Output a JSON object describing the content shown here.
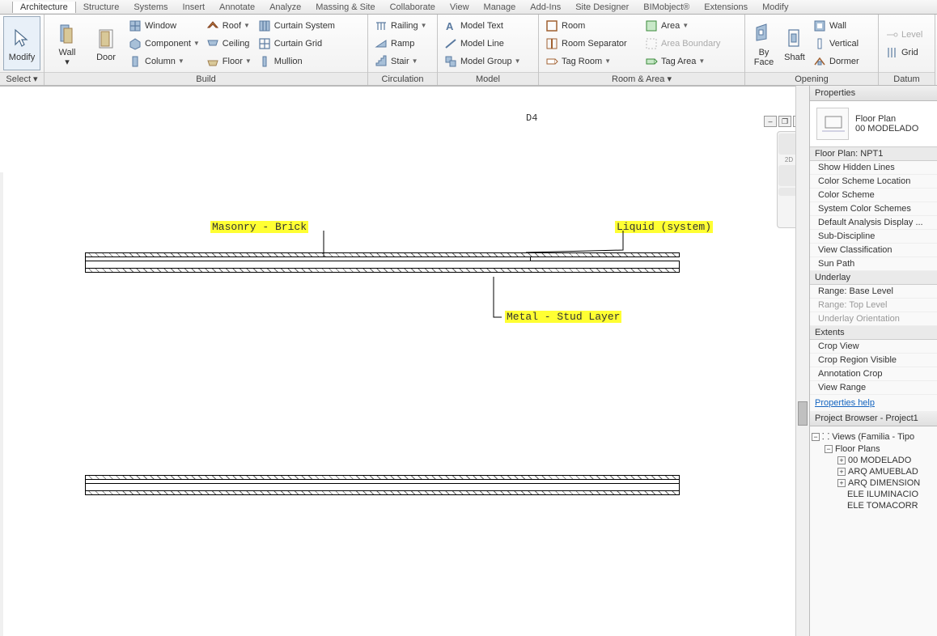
{
  "menu": {
    "tabs": [
      "Architecture",
      "Structure",
      "Systems",
      "Insert",
      "Annotate",
      "Analyze",
      "Massing & Site",
      "Collaborate",
      "View",
      "Manage",
      "Add-Ins",
      "Site Designer",
      "BIMobject®",
      "Extensions",
      "Modify"
    ],
    "active": "Architecture"
  },
  "ribbon": {
    "select": {
      "modify": "Modify",
      "label": "Select"
    },
    "build": {
      "wall": "Wall",
      "door": "Door",
      "window": "Window",
      "component": "Component",
      "column": "Column",
      "roof": "Roof",
      "ceiling": "Ceiling",
      "floor": "Floor",
      "curtain_system": "Curtain System",
      "curtain_grid": "Curtain Grid",
      "mullion": "Mullion",
      "label": "Build"
    },
    "circulation": {
      "railing": "Railing",
      "ramp": "Ramp",
      "stair": "Stair",
      "label": "Circulation"
    },
    "model": {
      "model_text": "Model Text",
      "model_line": "Model Line",
      "model_group": "Model Group",
      "label": "Model"
    },
    "room_area": {
      "room": "Room",
      "room_separator": "Room Separator",
      "tag_room": "Tag Room",
      "area": "Area",
      "area_boundary": "Area Boundary",
      "tag_area": "Tag Area",
      "label": "Room & Area"
    },
    "opening": {
      "by_face": "By Face",
      "shaft": "Shaft",
      "wall": "Wall",
      "vertical": "Vertical",
      "dormer": "Dormer",
      "label": "Opening"
    },
    "datum": {
      "level": "Level",
      "grid": "Grid",
      "label": "Datum"
    }
  },
  "canvas": {
    "grid_label": "D4",
    "tags": {
      "masonry": "Masonry - Brick",
      "liquid": "Liquid (system)",
      "metal": "Metal - Stud Layer"
    }
  },
  "properties": {
    "title": "Properties",
    "type_name": "Floor Plan",
    "type_sub": "00 MODELADO",
    "instance_header": "Floor Plan: NPT1",
    "rows_graphics": [
      "Show Hidden Lines",
      "Color Scheme Location",
      "Color Scheme",
      "System Color Schemes",
      "Default Analysis Display ...",
      "Sub-Discipline",
      "View Classification",
      "Sun Path"
    ],
    "underlay_header": "Underlay",
    "rows_underlay": [
      "Range: Base Level",
      "Range: Top Level",
      "Underlay Orientation"
    ],
    "extents_header": "Extents",
    "rows_extents": [
      "Crop View",
      "Crop Region Visible",
      "Annotation Crop",
      "View Range"
    ],
    "help_link": "Properties help"
  },
  "browser": {
    "title": "Project Browser - Project1",
    "root": "Views (Familia - Tipo",
    "floor_plans": "Floor Plans",
    "items": [
      "00 MODELADO",
      "ARQ AMUEBLAD",
      "ARQ DIMENSION",
      "ELE ILUMINACIO",
      "ELE TOMACORR"
    ]
  }
}
